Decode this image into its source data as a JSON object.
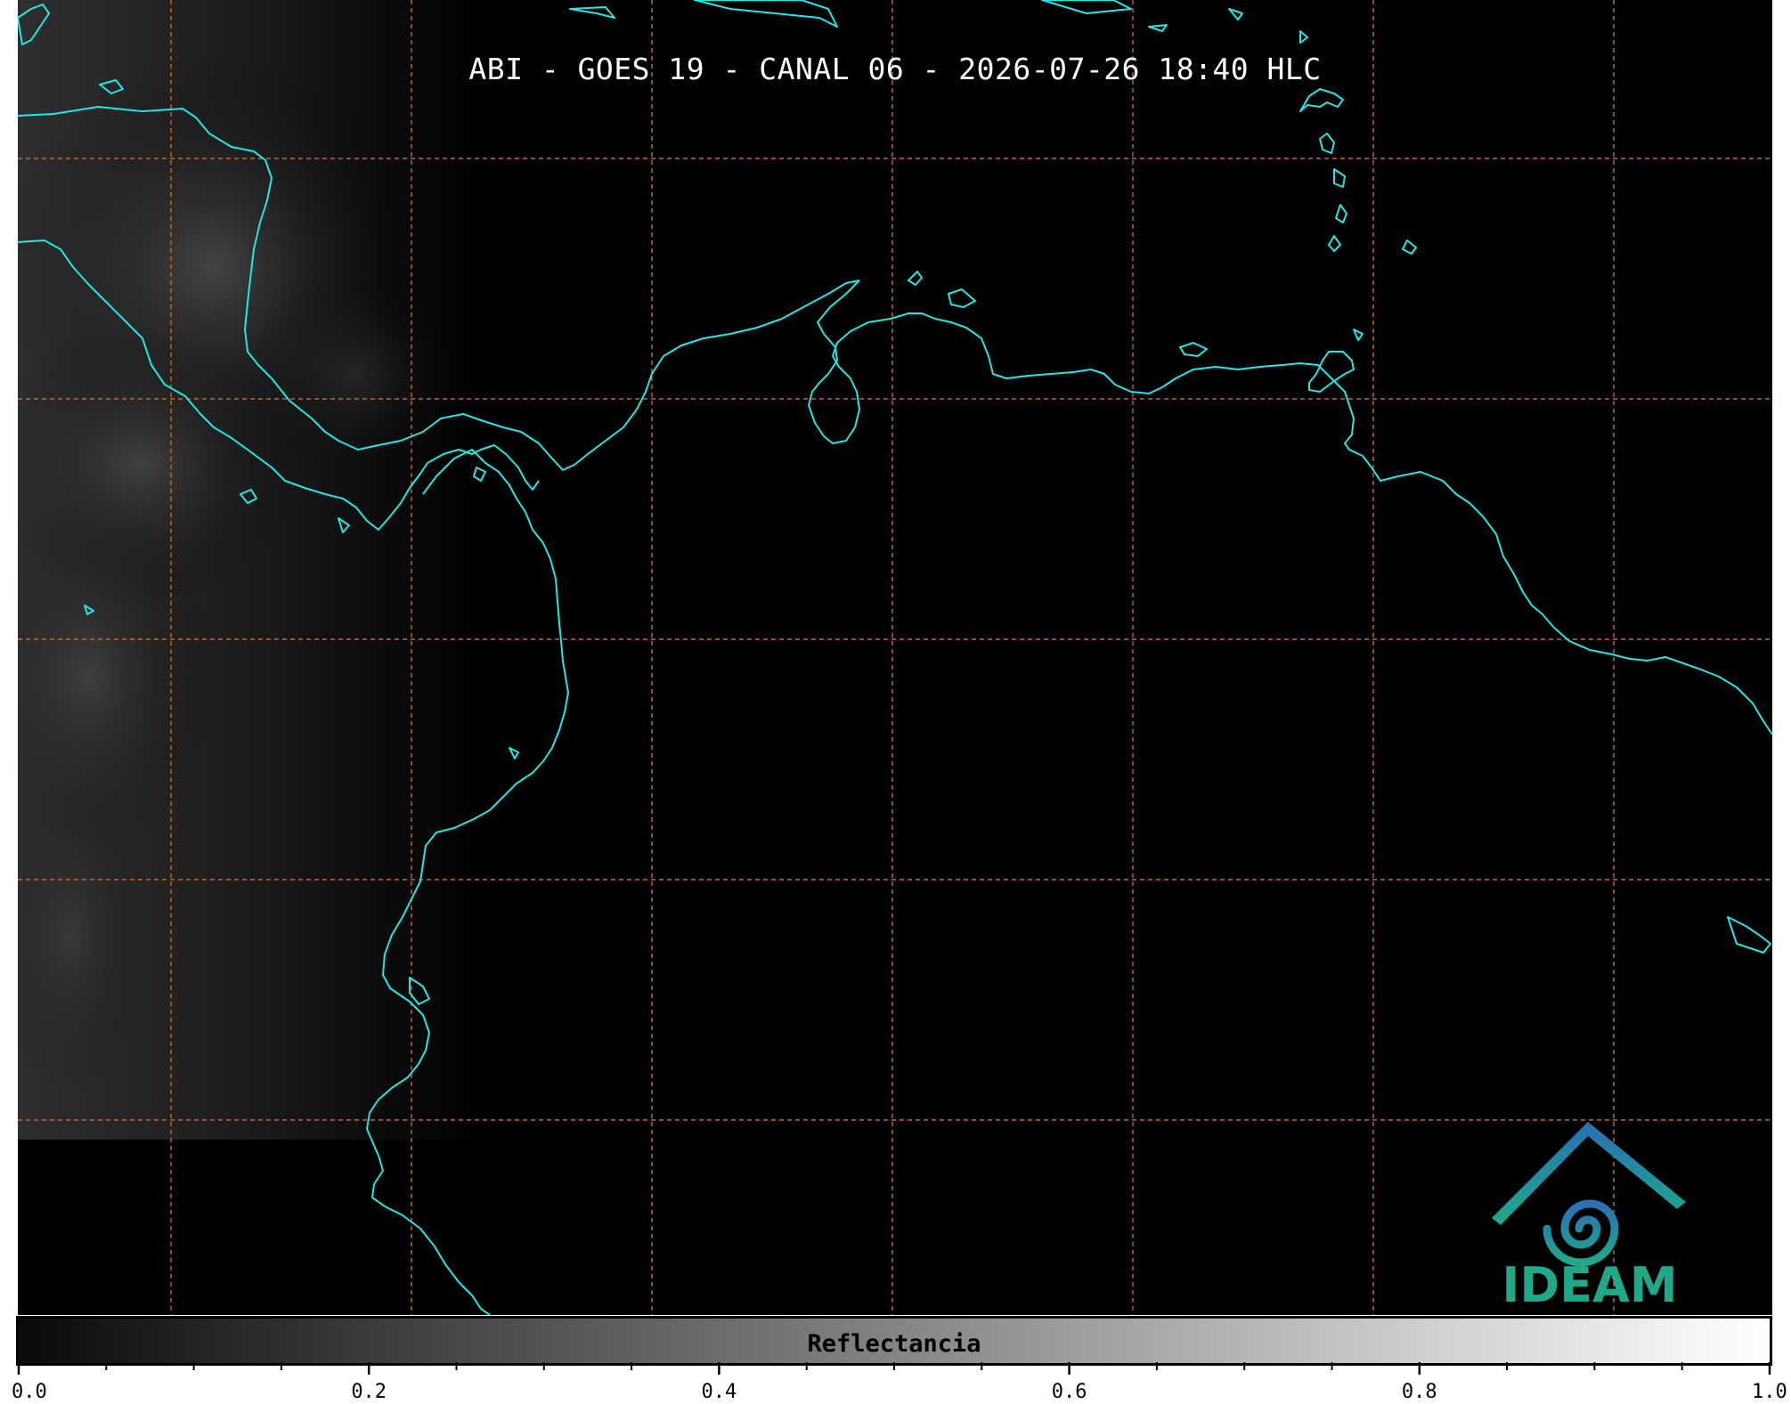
{
  "title": "ABI - GOES 19 - CANAL 06 - 2026-07-26 18:40 HLC",
  "colorbar": {
    "label": "Reflectancia",
    "range": [
      0.0,
      1.0
    ],
    "tick_labels": [
      "0.0",
      "0.2",
      "0.4",
      "0.6",
      "0.8",
      "1.0"
    ],
    "gradient_start": "#0a0a0a",
    "gradient_end": "#ffffff"
  },
  "logo": {
    "text": "IDEAM"
  },
  "colors": {
    "background": "#000000",
    "coastline": "#24e6e6",
    "gridlines": "#c8692a",
    "logo_blue": "#2a6fb5",
    "logo_teal": "#1fa98a"
  },
  "map": {
    "grid": "dashed",
    "coastlines": true
  }
}
